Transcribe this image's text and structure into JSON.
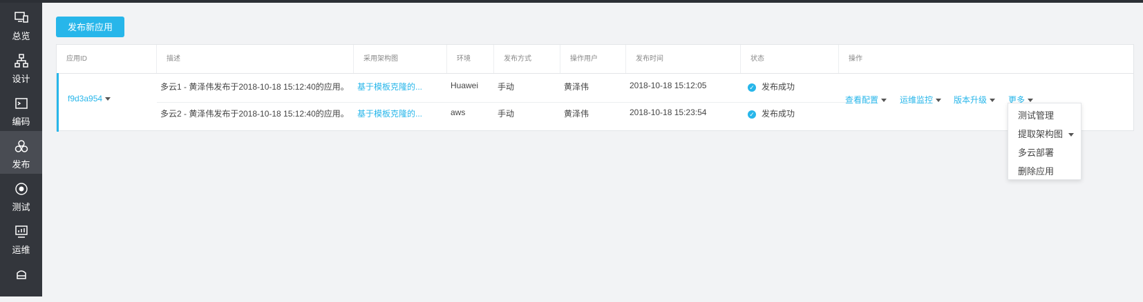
{
  "sidebar": {
    "items": [
      {
        "label": "总览",
        "icon": "monitor-icon"
      },
      {
        "label": "设计",
        "icon": "sitemap-icon"
      },
      {
        "label": "编码",
        "icon": "terminal-icon"
      },
      {
        "label": "发布",
        "icon": "cluster-icon",
        "active": true
      },
      {
        "label": "测试",
        "icon": "target-icon"
      },
      {
        "label": "运维",
        "icon": "dashboard-monitor-icon"
      },
      {
        "label": "",
        "icon": "drive-icon"
      }
    ]
  },
  "toolbar": {
    "publish_label": "发布新应用"
  },
  "table": {
    "headers": [
      "应用ID",
      "描述",
      "采用架构图",
      "环境",
      "发布方式",
      "操作用户",
      "发布时间",
      "状态",
      "操作"
    ],
    "app_id": "f9d3a954",
    "rows": [
      {
        "desc": "多云1 - 黄泽伟发布于2018-10-18 15:12:40的应用。",
        "arch": "基于模板克隆的...",
        "env": "Huawei",
        "method": "手动",
        "user": "黄泽伟",
        "time": "2018-10-18 15:12:05",
        "status": "发布成功"
      },
      {
        "desc": "多云2 - 黄泽伟发布于2018-10-18 15:12:40的应用。",
        "arch": "基于模板克隆的...",
        "env": "aws",
        "method": "手动",
        "user": "黄泽伟",
        "time": "2018-10-18 15:23:54",
        "status": "发布成功"
      }
    ],
    "actions": [
      "查看配置",
      "运维监控",
      "版本升级",
      "更多"
    ]
  },
  "dropdown": {
    "items": [
      "测试管理",
      "提取架构图",
      "多云部署",
      "删除应用"
    ]
  },
  "colors": {
    "accent": "#27b6ea",
    "sidebar": "#33363c",
    "sidebar_active": "#494c53"
  }
}
